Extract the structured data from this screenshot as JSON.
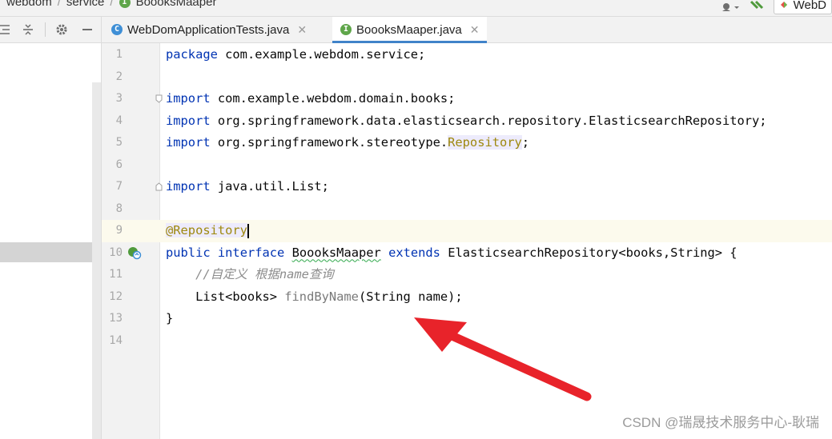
{
  "breadcrumb": {
    "items": [
      "webdom",
      "service",
      "BoooksMaaper"
    ]
  },
  "toolbar": {
    "run_config": "WebD"
  },
  "tabs": [
    {
      "label": "WebDomApplicationTests.java",
      "active": false,
      "icon": "class-icon"
    },
    {
      "label": "BoooksMaaper.java",
      "active": true,
      "icon": "interface-icon"
    }
  ],
  "editor": {
    "lines": [
      {
        "no": "1",
        "code": "package com.example.webdom.service;"
      },
      {
        "no": "2",
        "code": ""
      },
      {
        "no": "3",
        "code": "import com.example.webdom.domain.books;"
      },
      {
        "no": "4",
        "code": "import org.springframework.data.elasticsearch.repository.ElasticsearchRepository;"
      },
      {
        "no": "5",
        "code": "import org.springframework.stereotype.Repository;"
      },
      {
        "no": "6",
        "code": ""
      },
      {
        "no": "7",
        "code": "import java.util.List;"
      },
      {
        "no": "8",
        "code": ""
      },
      {
        "no": "9",
        "code": "@Repository"
      },
      {
        "no": "10",
        "code": "public interface BoooksMaaper extends ElasticsearchRepository<books,String> {"
      },
      {
        "no": "11",
        "code": "    //自定义 根据name查询"
      },
      {
        "no": "12",
        "code": "    List<books> findByName(String name);"
      },
      {
        "no": "13",
        "code": "}"
      },
      {
        "no": "14",
        "code": ""
      }
    ]
  },
  "colors": {
    "keyword": "#0033b3",
    "annotation": "#9e880d",
    "comment": "#8c8c8c",
    "tab_underline": "#4083c9",
    "arrow": "#e8232a"
  },
  "watermark": "CSDN @瑞晟技术服务中心-耿瑞"
}
